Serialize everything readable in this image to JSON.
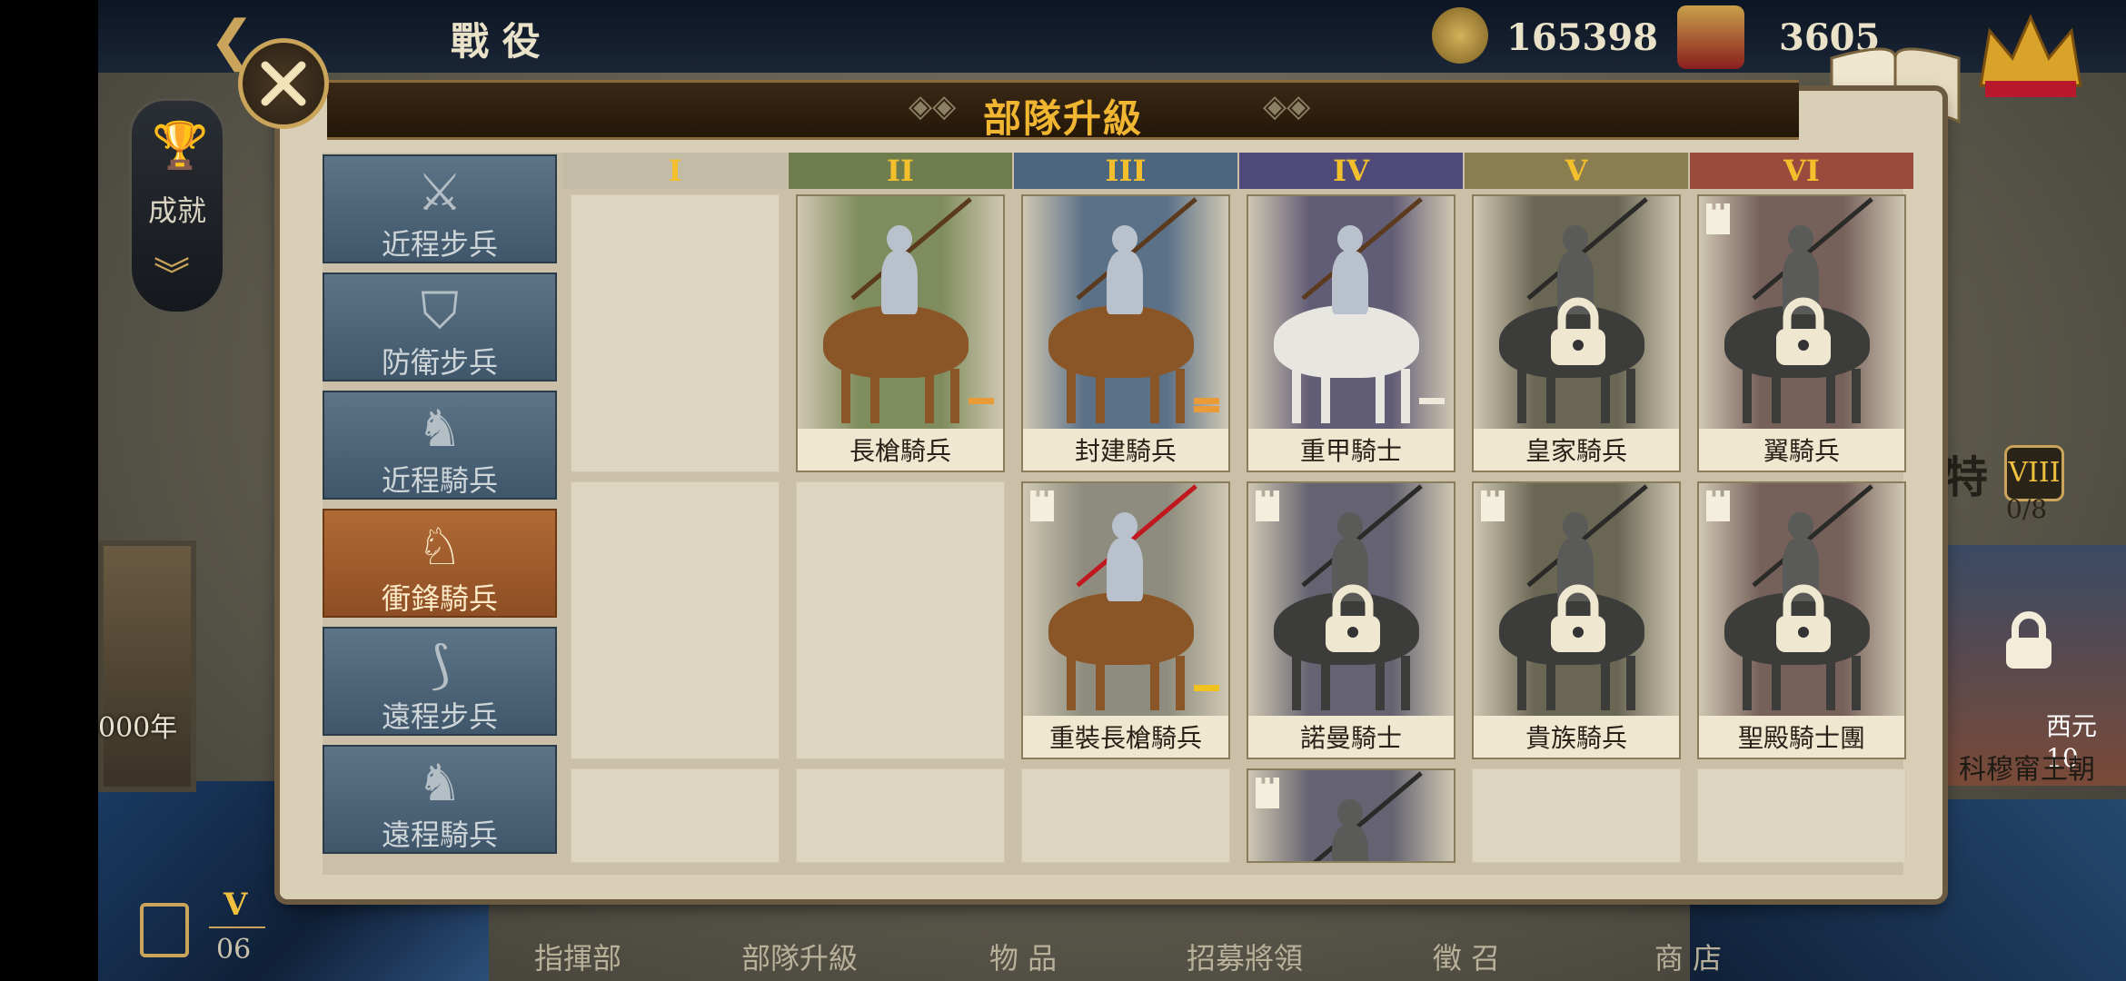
{
  "topbar": {
    "section_title": "戰 役",
    "gold_amount": "165398",
    "medal_amount": "3605",
    "encyclopedia_label": "圖鑑"
  },
  "achievement": {
    "label": "成就"
  },
  "background": {
    "left_era_year": "000年",
    "right_era_roman": "VIII",
    "right_era_progress": "0/8",
    "right_era_year": "西元10",
    "right_era_name": "科穆甯王朝",
    "right_glyph": "特"
  },
  "panel": {
    "title": "部隊升級",
    "tiers": [
      "I",
      "II",
      "III",
      "IV",
      "V",
      "VI"
    ],
    "tier_colors": [
      "#c2bba6",
      "#6f7d4e",
      "#4c6680",
      "#4f4a7a",
      "#8a7e50",
      "#9b4b3d"
    ],
    "categories": [
      {
        "label": "近程步兵",
        "icon": "crossed-swords-icon",
        "active": false
      },
      {
        "label": "防衛步兵",
        "icon": "shield-icon",
        "active": false
      },
      {
        "label": "近程騎兵",
        "icon": "horse-head-icon",
        "active": false
      },
      {
        "label": "衝鋒騎兵",
        "icon": "charging-horse-icon",
        "active": true
      },
      {
        "label": "遠程步兵",
        "icon": "bow-icon",
        "active": false
      },
      {
        "label": "遠程騎兵",
        "icon": "mounted-archer-icon",
        "active": false
      }
    ],
    "units": [
      {
        "name": "長槍騎兵",
        "row": 0,
        "tier": 1,
        "locked": false,
        "tower": false,
        "bg": "#7f8c5d",
        "bar_color": "#e89b36",
        "bar_count": 1
      },
      {
        "name": "封建騎兵",
        "row": 0,
        "tier": 2,
        "locked": false,
        "tower": false,
        "bg": "#5b7188",
        "bar_color": "#e89b36",
        "bar_count": 2
      },
      {
        "name": "重甲騎士",
        "row": 0,
        "tier": 3,
        "locked": false,
        "tower": false,
        "bg": "#625d76",
        "bar_color": "#efe9dc",
        "bar_count": 1
      },
      {
        "name": "皇家騎兵",
        "row": 0,
        "tier": 4,
        "locked": true,
        "tower": false,
        "bg": "#6a6654",
        "bar_color": "",
        "bar_count": 0
      },
      {
        "name": "翼騎兵",
        "row": 0,
        "tier": 5,
        "locked": true,
        "tower": true,
        "bg": "#76605a",
        "bar_color": "",
        "bar_count": 0
      },
      {
        "name": "重裝長槍騎兵",
        "row": 1,
        "tier": 2,
        "locked": false,
        "tower": true,
        "bg": "#8d8c7e",
        "bar_color": "#f1c21e",
        "bar_count": 1
      },
      {
        "name": "諾曼騎士",
        "row": 1,
        "tier": 3,
        "locked": true,
        "tower": true,
        "bg": "#656371",
        "bar_color": "",
        "bar_count": 0
      },
      {
        "name": "貴族騎兵",
        "row": 1,
        "tier": 4,
        "locked": true,
        "tower": true,
        "bg": "#6a6654",
        "bar_color": "",
        "bar_count": 0
      },
      {
        "name": "聖殿騎士團",
        "row": 1,
        "tier": 5,
        "locked": true,
        "tower": true,
        "bg": "#76605a",
        "bar_color": "",
        "bar_count": 0
      },
      {
        "name": "",
        "row": 2,
        "tier": 3,
        "locked": true,
        "tower": true,
        "bg": "#656371",
        "bar_color": "",
        "bar_count": 0
      }
    ]
  },
  "save": {
    "roman": "V",
    "number": "06"
  },
  "bottom_nav": [
    "指揮部",
    "部隊升級",
    "物 品",
    "招募將領",
    "徵 召",
    "商 店"
  ]
}
